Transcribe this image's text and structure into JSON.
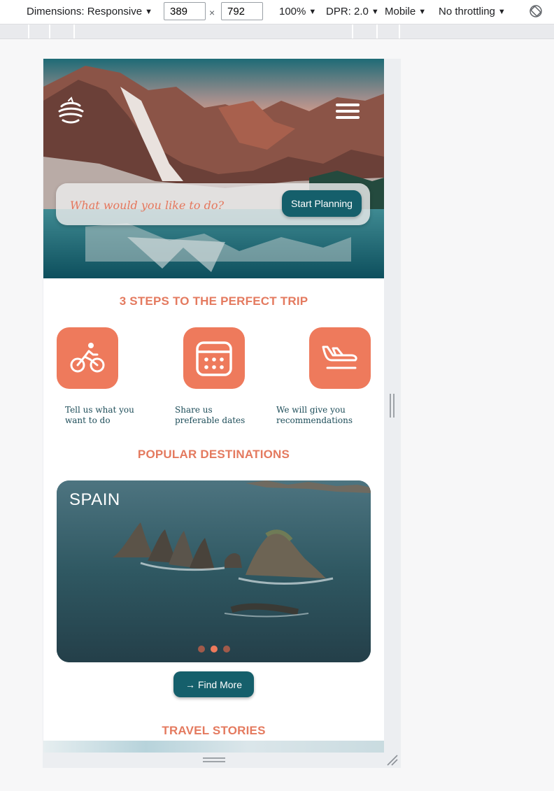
{
  "devtools": {
    "dimensions_label": "Dimensions: Responsive",
    "width": "389",
    "height": "792",
    "times": "×",
    "zoom": "100%",
    "dpr": "DPR: 2.0",
    "device_type": "Mobile",
    "throttling": "No throttling",
    "caret": "▼"
  },
  "hero": {
    "search_placeholder": "What would you like to do?",
    "start_planning": "Start Planning"
  },
  "steps": {
    "title": "3 STEPS TO THE PERFECT TRIP",
    "items": [
      {
        "icon": "bicycle-icon",
        "text": "Tell us what you want to do"
      },
      {
        "icon": "calendar-icon",
        "text": "Share us preferable dates"
      },
      {
        "icon": "airplane-landing-icon",
        "text": "We will give you recommendations"
      }
    ]
  },
  "destinations": {
    "title": "POPULAR DESTINATIONS",
    "current": "SPAIN",
    "active_slide": 2,
    "slide_count": 3,
    "find_more": "Find More",
    "find_more_arrow": "→"
  },
  "stories": {
    "title": "TRAVEL STORIES"
  },
  "colors": {
    "accent": "#e47a5f",
    "teal": "#155f6b",
    "text_dark": "#1d4d59"
  }
}
